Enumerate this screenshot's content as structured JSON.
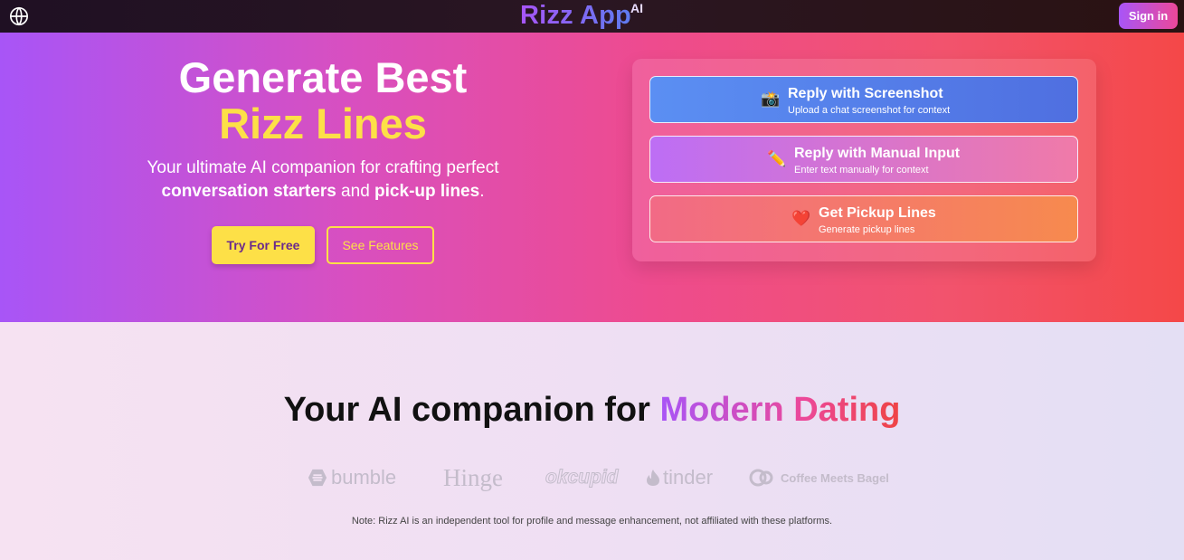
{
  "header": {
    "brand": "Rizz App",
    "brand_sup": "AI",
    "signin_label": "Sign in"
  },
  "hero": {
    "title_line1": "Generate Best",
    "title_line2": "Rizz Lines",
    "subtitle_line1": "Your ultimate AI companion for crafting perfect",
    "subtitle_bold1": "conversation starters",
    "subtitle_and": " and ",
    "subtitle_bold2": "pick-up lines",
    "subtitle_end": ".",
    "try_label": "Try For Free",
    "features_label": "See Features"
  },
  "options": [
    {
      "icon": "📸",
      "title": "Reply with Screenshot",
      "desc": "Upload a chat screenshot for context"
    },
    {
      "icon": "✏️",
      "title": "Reply with Manual Input",
      "desc": "Enter text manually for context"
    },
    {
      "icon": "❤️",
      "title": "Get Pickup Lines",
      "desc": "Generate pickup lines"
    }
  ],
  "lower": {
    "heading_plain": "Your AI companion for ",
    "heading_grad": "Modern Dating",
    "logos": [
      "bumble",
      "Hinge",
      "okcupid",
      "tinder",
      "Coffee Meets Bagel"
    ],
    "note": "Note: Rizz AI is an independent tool for profile and message enhancement, not affiliated with these platforms."
  },
  "colors": {
    "accent_yellow": "#fde047",
    "accent_purple": "#a855f7",
    "accent_pink": "#ec4899"
  },
  "icons": {
    "globe": "globe-icon",
    "screenshot": "camera-icon",
    "manual": "pencil-icon",
    "pickup": "heart-icon"
  }
}
